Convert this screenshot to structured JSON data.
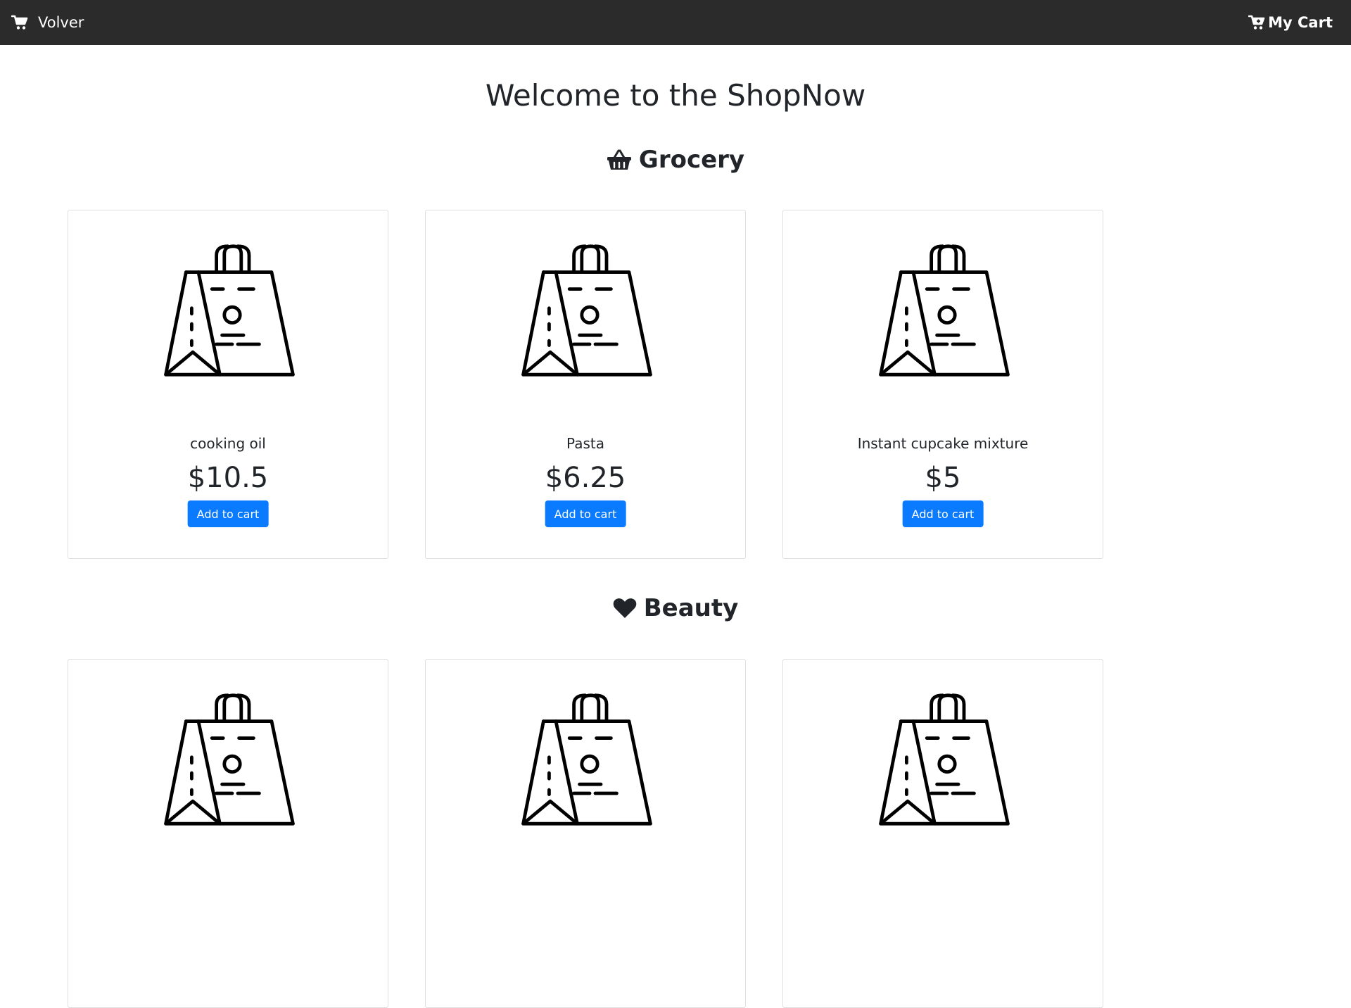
{
  "navbar": {
    "brand_label": "Volver",
    "brand_icon": "shopping-cart-icon",
    "cart_label": "My Cart",
    "cart_icon": "cart-plus-icon",
    "background": "#2b2b2b"
  },
  "welcome_title": "Welcome to the ShopNow",
  "categories": [
    {
      "name": "Grocery",
      "icon": "basket-icon",
      "products": [
        {
          "name": "cooking oil",
          "price": "$10.5",
          "button": "Add to cart",
          "image_icon": "shopping-bag-icon"
        },
        {
          "name": "Pasta",
          "price": "$6.25",
          "button": "Add to cart",
          "image_icon": "shopping-bag-icon"
        },
        {
          "name": "Instant cupcake mixture",
          "price": "$5",
          "button": "Add to cart",
          "image_icon": "shopping-bag-icon"
        }
      ]
    },
    {
      "name": "Beauty",
      "icon": "heart-icon",
      "products": [
        {
          "image_icon": "shopping-bag-icon"
        },
        {
          "image_icon": "shopping-bag-icon"
        },
        {
          "image_icon": "shopping-bag-icon"
        }
      ]
    }
  ],
  "colors": {
    "accent": "#0a7bff",
    "text": "#212529",
    "card_border": "#dfdfdf"
  }
}
